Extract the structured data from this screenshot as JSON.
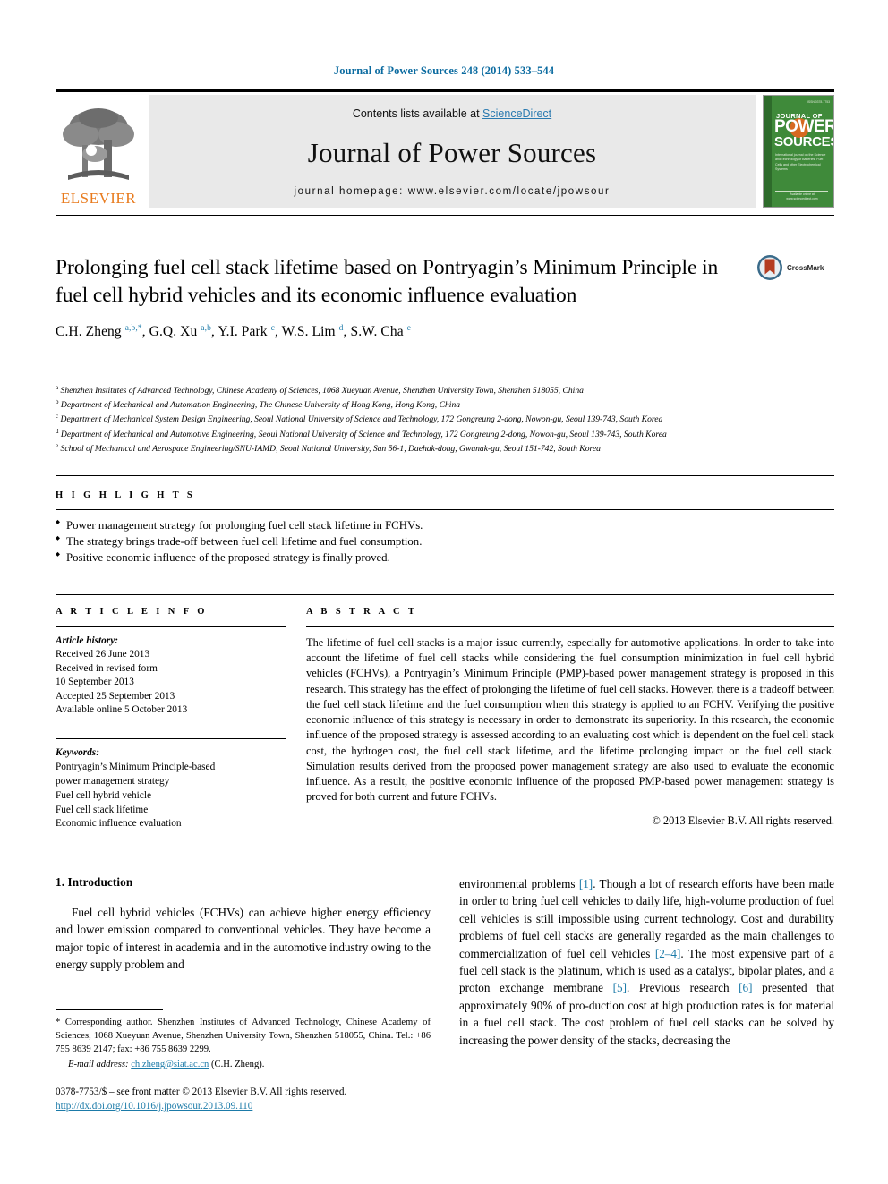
{
  "running_head": "Journal of Power Sources 248 (2014) 533–544",
  "masthead": {
    "publisher_name": "ELSEVIER",
    "contents_prefix": "Contents lists available at ",
    "contents_link": "ScienceDirect",
    "journal_name": "Journal of Power Sources",
    "homepage": "journal homepage: www.elsevier.com/locate/jpowsour",
    "cover": {
      "top_line": "ISSN 0378-7753",
      "journal_of": "JOURNAL OF",
      "power": "POWER",
      "sources": "SOURCES",
      "subtitle": "International journal on the Science and Technology of Batteries, Fuel Cells and other Electrochemical Systems",
      "footer": "Available online at www.sciencedirect.com"
    }
  },
  "article": {
    "title": "Prolonging fuel cell stack lifetime based on Pontryagin’s Minimum Principle in fuel cell hybrid vehicles and its economic influence evaluation",
    "crossmark_label": "CrossMark",
    "authors_html": "C.H. Zheng <sup>a,b,*</sup>, G.Q. Xu <sup>a,b</sup>, Y.I. Park <sup>c</sup>, W.S. Lim <sup>d</sup>, S.W. Cha <sup>e</sup>",
    "affiliations": [
      {
        "marker": "a",
        "text": "Shenzhen Institutes of Advanced Technology, Chinese Academy of Sciences, 1068 Xueyuan Avenue, Shenzhen University Town, Shenzhen 518055, China"
      },
      {
        "marker": "b",
        "text": "Department of Mechanical and Automation Engineering, The Chinese University of Hong Kong, Hong Kong, China"
      },
      {
        "marker": "c",
        "text": "Department of Mechanical System Design Engineering, Seoul National University of Science and Technology, 172 Gongreung 2-dong, Nowon-gu, Seoul 139-743, South Korea"
      },
      {
        "marker": "d",
        "text": "Department of Mechanical and Automotive Engineering, Seoul National University of Science and Technology, 172 Gongreung 2-dong, Nowon-gu, Seoul 139-743, South Korea"
      },
      {
        "marker": "e",
        "text": "School of Mechanical and Aerospace Engineering/SNU-IAMD, Seoul National University, San 56-1, Daehak-dong, Gwanak-gu, Seoul 151-742, South Korea"
      }
    ]
  },
  "highlights": {
    "label": "H I G H L I G H T S",
    "items": [
      "Power management strategy for prolonging fuel cell stack lifetime in FCHVs.",
      "The strategy brings trade-off between fuel cell lifetime and fuel consumption.",
      "Positive economic influence of the proposed strategy is finally proved."
    ]
  },
  "article_info": {
    "label": "A R T I C L E   I N F O",
    "history_label": "Article history:",
    "history": [
      "Received 26 June 2013",
      "Received in revised form",
      "10 September 2013",
      "Accepted 25 September 2013",
      "Available online 5 October 2013"
    ],
    "keywords_label": "Keywords:",
    "keywords": [
      "Pontryagin’s Minimum Principle-based",
      "power management strategy",
      "Fuel cell hybrid vehicle",
      "Fuel cell stack lifetime",
      "Economic influence evaluation"
    ]
  },
  "abstract": {
    "label": "A B S T R A C T",
    "text": "The lifetime of fuel cell stacks is a major issue currently, especially for automotive applications. In order to take into account the lifetime of fuel cell stacks while considering the fuel consumption minimization in fuel cell hybrid vehicles (FCHVs), a Pontryagin’s Minimum Principle (PMP)-based power management strategy is proposed in this research. This strategy has the effect of prolonging the lifetime of fuel cell stacks. However, there is a tradeoff between the fuel cell stack lifetime and the fuel consumption when this strategy is applied to an FCHV. Verifying the positive economic influence of this strategy is necessary in order to demonstrate its superiority. In this research, the economic influence of the proposed strategy is assessed according to an evaluating cost which is dependent on the fuel cell stack cost, the hydrogen cost, the fuel cell stack lifetime, and the lifetime prolonging impact on the fuel cell stack. Simulation results derived from the proposed power management strategy are also used to evaluate the economic influence. As a result, the positive economic influence of the proposed PMP-based power management strategy is proved for both current and future FCHVs.",
    "copyright": "© 2013 Elsevier B.V. All rights reserved."
  },
  "body": {
    "section_number_title": "1. Introduction",
    "left_paragraph": "Fuel cell hybrid vehicles (FCHVs) can achieve higher energy efficiency and lower emission compared to conventional vehicles. They have become a major topic of interest in academia and in the automotive industry owing to the energy supply problem and",
    "right_paragraph_html": "environmental problems <span class=\"ref\">[1]</span>. Though a lot of research efforts have been made in order to bring fuel cell vehicles to daily life, high-volume production of fuel cell vehicles is still impossible using current technology. Cost and durability problems of fuel cell stacks are generally regarded as the main challenges to commercialization of fuel cell vehicles <span class=\"ref\">[2&#8211;4]</span>. The most expensive part of a fuel cell stack is the platinum, which is used as a catalyst, bipolar plates, and a proton exchange membrane <span class=\"ref\">[5]</span>. Previous research <span class=\"ref\">[6]</span> presented that approximately 90% of pro-duction cost at high production rates is for material in a fuel cell stack. The cost problem of fuel cell stacks can be solved by increasing the power density of the stacks, decreasing the"
  },
  "footnote": {
    "corresponding": "* Corresponding author. Shenzhen Institutes of Advanced Technology, Chinese Academy of Sciences, 1068 Xueyuan Avenue, Shenzhen University Town, Shenzhen 518055, China. Tel.: +86 755 8639 2147; fax: +86 755 8639 2299.",
    "email_label": "E-mail address:",
    "email": "ch.zheng@siat.ac.cn",
    "email_suffix": "(C.H. Zheng)."
  },
  "page_footer": {
    "issn_line": "0378-7753/$ – see front matter © 2013 Elsevier B.V. All rights reserved.",
    "doi": "http://dx.doi.org/10.1016/j.jpowsour.2013.09.110"
  },
  "colors": {
    "link_blue": "#1b7aa8",
    "sciencedirect_blue": "#2a7ab0",
    "elsevier_orange": "#e87b1e",
    "cover_green": "#3f8a3a"
  }
}
